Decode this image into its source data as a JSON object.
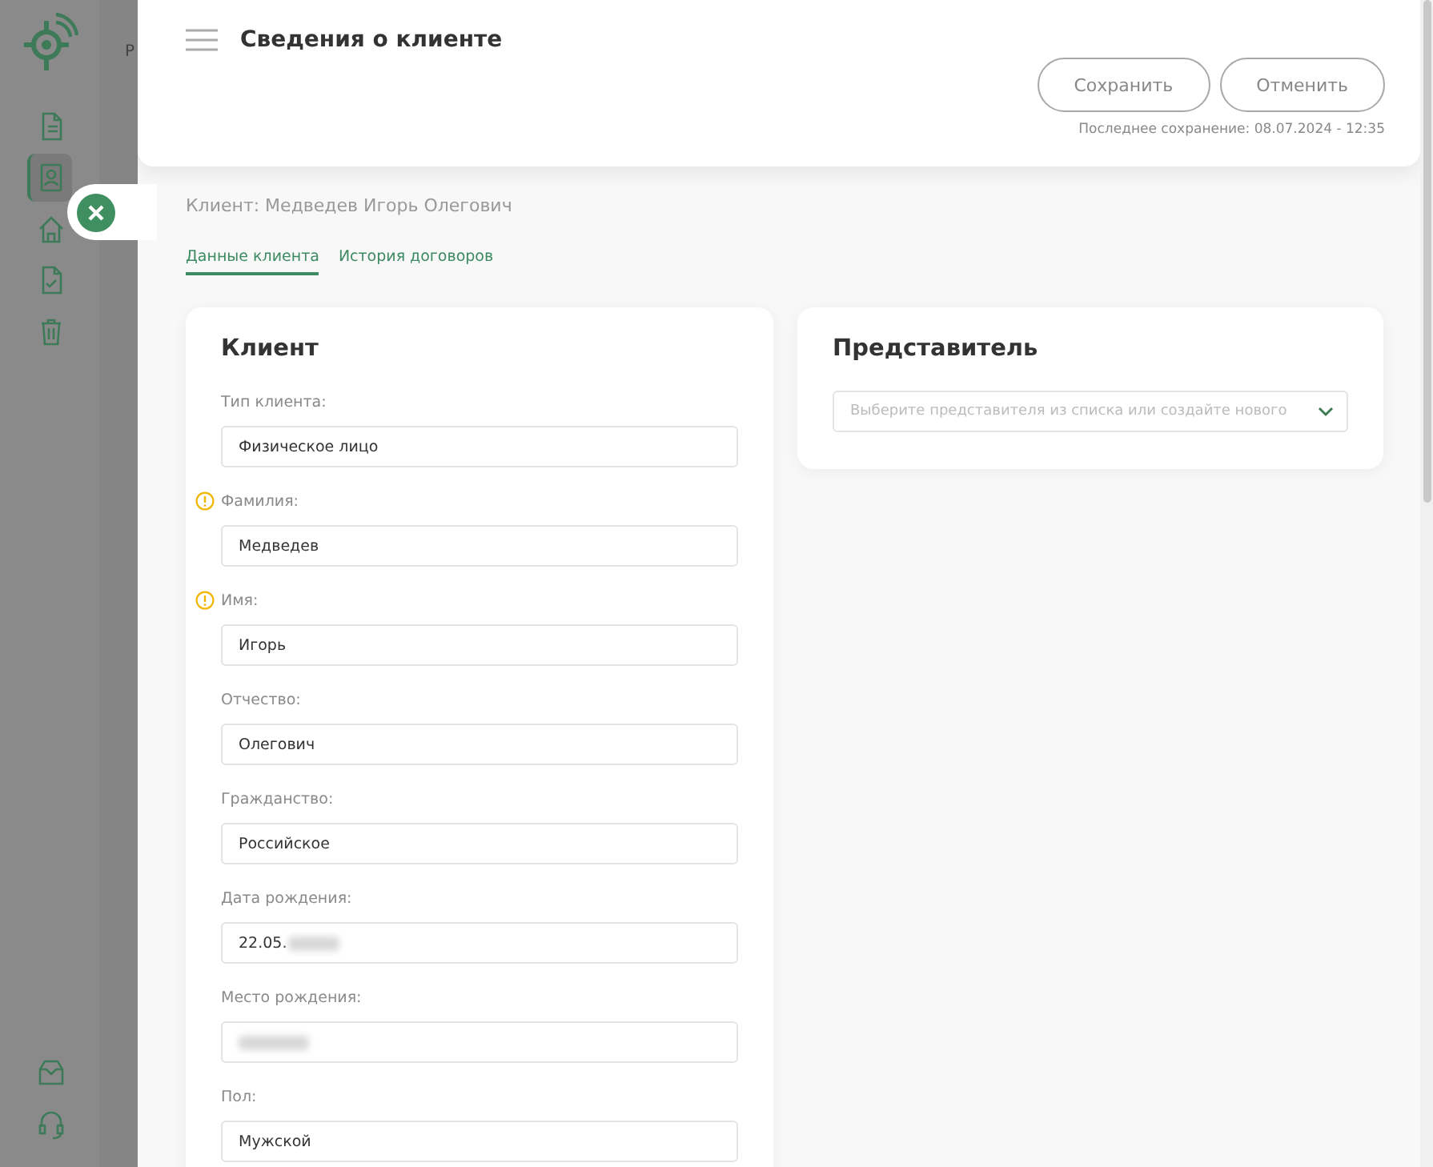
{
  "sidebar": {
    "items": [
      {
        "selected": false
      },
      {
        "selected": true
      },
      {
        "selected": false
      },
      {
        "selected": false
      },
      {
        "selected": false
      }
    ],
    "bottom_items": [
      {
        "selected": false
      },
      {
        "selected": false
      }
    ]
  },
  "page_behind": {
    "breadcrumb": "Р"
  },
  "drawer": {
    "title": "Сведения о клиенте",
    "buttons": [
      "Сохранить",
      "Отменить"
    ],
    "last_saved": "Последнее сохранение: 08.07.2024 - 12:35",
    "client_line": "Клиент: Медведев Игорь Олегович",
    "tabs": [
      {
        "label": "Данные клиента",
        "selected": true
      },
      {
        "label": "История договоров",
        "selected": false
      }
    ],
    "client_card": {
      "title": "Клиент",
      "fields": [
        {
          "label": "Тип клиента:",
          "value": "Физическое лицо",
          "warning": false,
          "redacted": false
        },
        {
          "label": "Фамилия:",
          "value": "Медведев",
          "warning": true,
          "redacted": false
        },
        {
          "label": "Имя:",
          "value": "Игорь",
          "warning": true,
          "redacted": false
        },
        {
          "label": "Отчество:",
          "value": "Олегович",
          "warning": false,
          "redacted": false
        },
        {
          "label": "Гражданство:",
          "value": "Российское",
          "warning": false,
          "redacted": false
        },
        {
          "label": "Дата рождения:",
          "value": "22.05.",
          "warning": false,
          "redacted": true
        },
        {
          "label": "Место рождения:",
          "warning": false,
          "redacted": true
        },
        {
          "label": "Пол:",
          "value": "Мужской",
          "warning": false,
          "redacted": false
        }
      ]
    },
    "representative_card": {
      "title": "Представитель",
      "select": {
        "placeholder": "Выберите представителя из списка или создайте нового"
      }
    }
  }
}
